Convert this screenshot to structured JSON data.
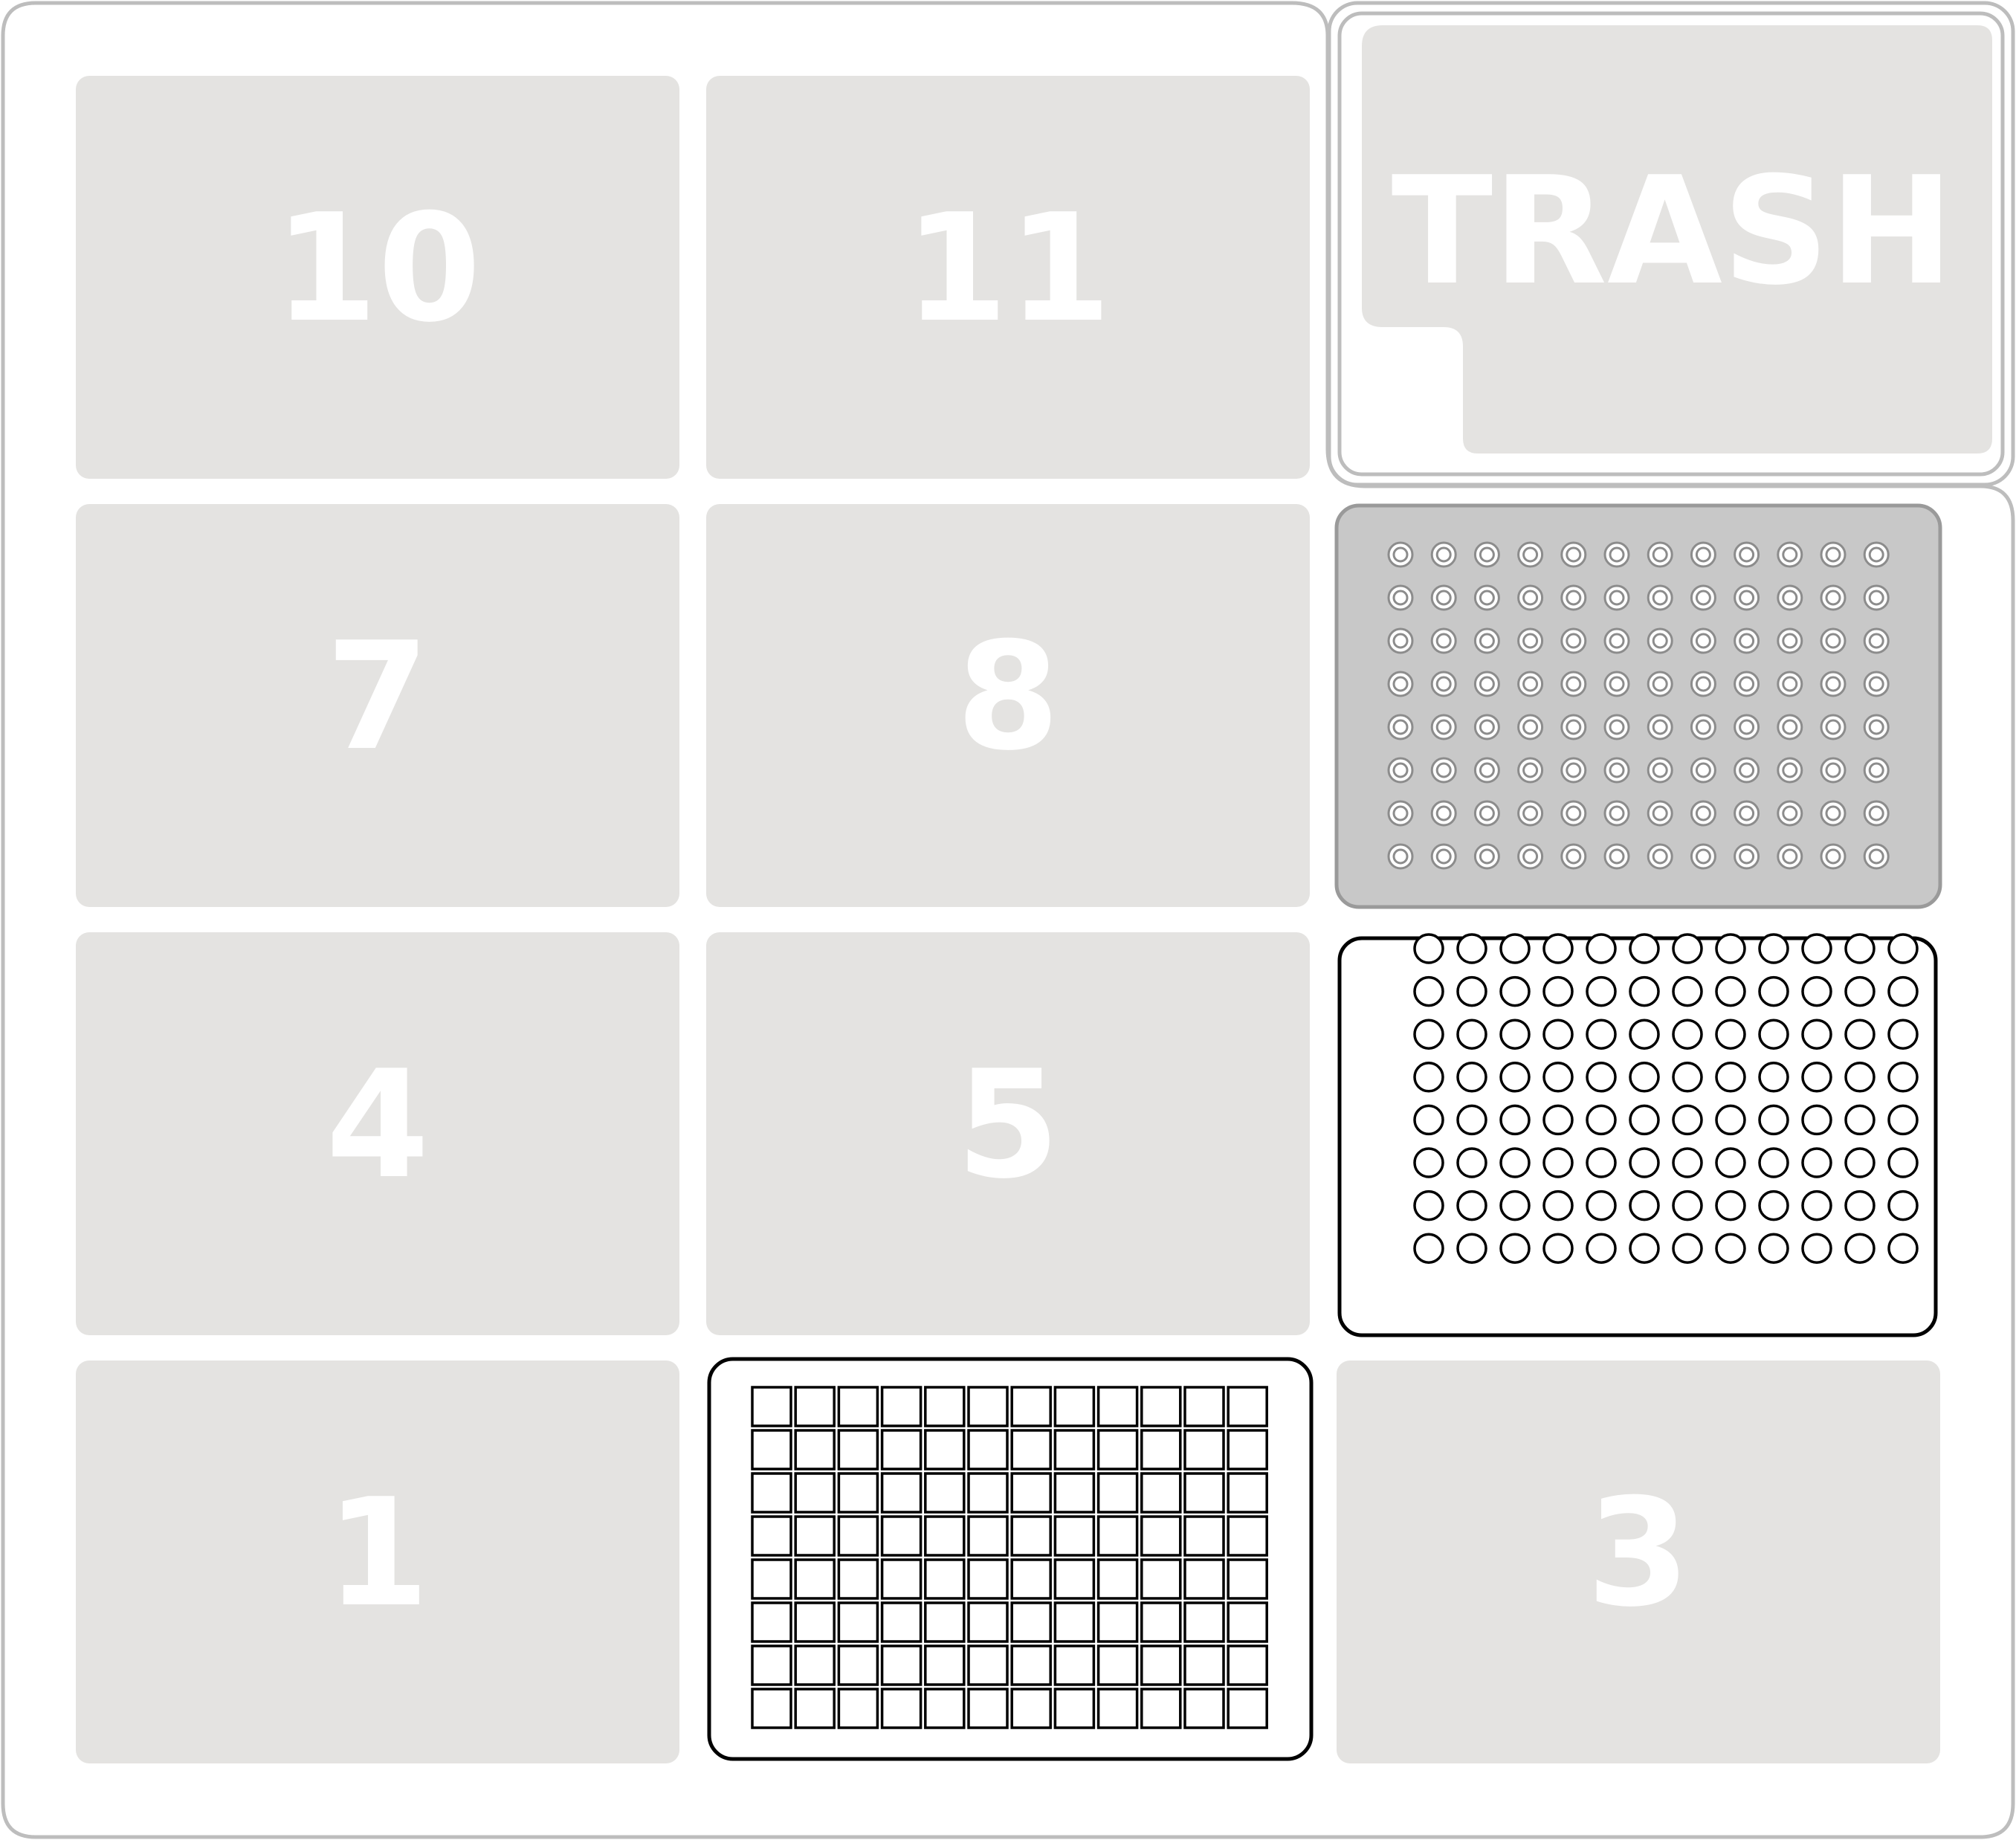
{
  "deck": {
    "slots": [
      {
        "id": "10",
        "label": "10"
      },
      {
        "id": "11",
        "label": "11"
      },
      {
        "id": "7",
        "label": "7"
      },
      {
        "id": "8",
        "label": "8"
      },
      {
        "id": "4",
        "label": "4"
      },
      {
        "id": "5",
        "label": "5"
      },
      {
        "id": "1",
        "label": "1"
      },
      {
        "id": "3",
        "label": "3"
      }
    ],
    "trash": {
      "label": "TRASH"
    },
    "labware": {
      "slot9_plate": {
        "rows": 8,
        "cols": 12,
        "kind": "well-plate-gray"
      },
      "slot6_plate": {
        "rows": 8,
        "cols": 12,
        "kind": "well-plate-outline"
      },
      "slot2_rack": {
        "rows": 8,
        "cols": 12,
        "kind": "tip-rack-square"
      }
    },
    "colors": {
      "slot_fill": "#e4e3e1",
      "outline": "#bdbdbd",
      "plate_gray": "#c8c8c8",
      "plate_border": "#9a9a9a",
      "ink": "#000000"
    }
  }
}
